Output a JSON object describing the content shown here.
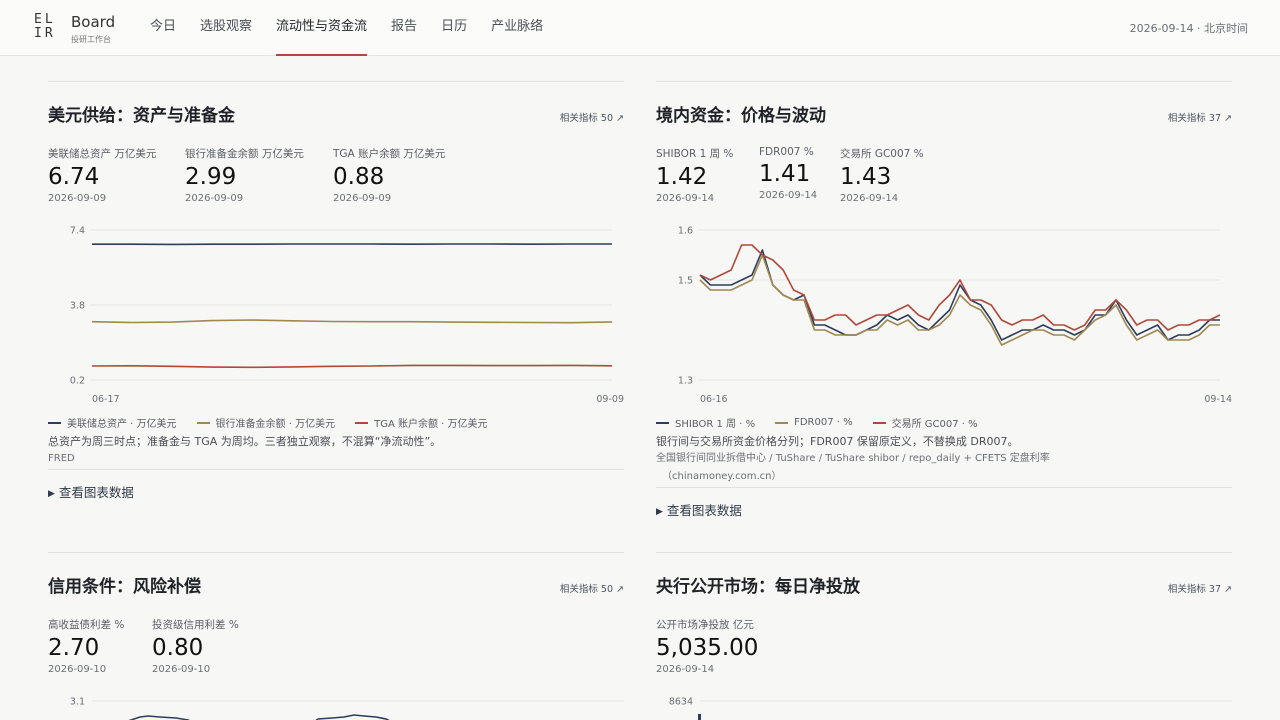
{
  "header": {
    "logo_mark_top": "EL",
    "logo_mark_bottom": "IR",
    "brand": "Board",
    "subtitle": "投研工作台",
    "nav": [
      "今日",
      "选股观察",
      "流动性与资金流",
      "报告",
      "日历",
      "产业脉络"
    ],
    "active_nav": "流动性与资金流",
    "date_time": "2026-09-14 · 北京时间"
  },
  "cards": {
    "usd_supply": {
      "title": "美元供给：资产与准备金",
      "link": "相关指标 50 ↗",
      "metrics": [
        {
          "label": "美联储总资产 万亿美元",
          "value": "6.74",
          "date": "2026-09-09"
        },
        {
          "label": "银行准备金余额 万亿美元",
          "value": "2.99",
          "date": "2026-09-09"
        },
        {
          "label": "TGA 账户余额 万亿美元",
          "value": "0.88",
          "date": "2026-09-09"
        }
      ],
      "legend": [
        "美联储总资产 · 万亿美元",
        "银行准备金余额 · 万亿美元",
        "TGA 账户余额 · 万亿美元"
      ],
      "note": "总资产为周三时点；准备金与 TGA 为周均。三者独立观察，不混算“净流动性”。",
      "source": "FRED",
      "toggle": "查看图表数据"
    },
    "domestic_funding": {
      "title": "境内资金：价格与波动",
      "link": "相关指标 37 ↗",
      "metrics": [
        {
          "label": "SHIBOR 1 周 %",
          "value": "1.42",
          "date": "2026-09-14"
        },
        {
          "label": "FDR007 %",
          "value": "1.41",
          "date": "2026-09-14"
        },
        {
          "label": "交易所 GC007 %",
          "value": "1.43",
          "date": "2026-09-14"
        }
      ],
      "legend": [
        "SHIBOR 1 周 · %",
        "FDR007 · %",
        "交易所 GC007 · %"
      ],
      "note": "银行间与交易所资金价格分列；FDR007 保留原定义，不替换成 DR007。",
      "source_line1": "全国银行间同业拆借中心 / TuShare / TuShare shibor / repo_daily + CFETS 定盘利率",
      "source_line2": "（chinamoney.com.cn）",
      "toggle": "查看图表数据"
    },
    "credit": {
      "title": "信用条件：风险补偿",
      "link": "相关指标 50 ↗",
      "metrics": [
        {
          "label": "高收益债利差 %",
          "value": "2.70",
          "date": "2026-09-10"
        },
        {
          "label": "投资级信用利差 %",
          "value": "0.80",
          "date": "2026-09-10"
        }
      ]
    },
    "pboc_omo": {
      "title": "央行公开市场：每日净投放",
      "link": "相关指标 37 ↗",
      "metrics": [
        {
          "label": "公开市场净投放 亿元",
          "value": "5,035.00",
          "date": "2026-09-14"
        }
      ]
    }
  },
  "colors": {
    "navy": "#2c3e5c",
    "olive": "#a08850",
    "red": "#b0493b",
    "accent_underline": "#b0493b"
  },
  "chart_data": [
    {
      "type": "line",
      "title": "美元供给：资产与准备金",
      "x_labels": [
        "06-17",
        "09-09"
      ],
      "ylim": [
        0.2,
        7.4
      ],
      "yticks": [
        7.4,
        3.8,
        0.2
      ],
      "series": [
        {
          "name": "美联储总资产 · 万亿美元",
          "color": "#2c3e5c",
          "values": [
            6.72,
            6.72,
            6.71,
            6.72,
            6.72,
            6.73,
            6.73,
            6.73,
            6.72,
            6.73,
            6.73,
            6.72,
            6.73,
            6.73
          ]
        },
        {
          "name": "银行准备金余额 · 万亿美元",
          "color": "#a08850",
          "values": [
            3.0,
            2.96,
            2.98,
            3.05,
            3.08,
            3.04,
            3.01,
            3.0,
            3.0,
            2.98,
            2.97,
            2.96,
            2.95,
            2.99
          ]
        },
        {
          "name": "TGA 账户余额 · 万亿美元",
          "color": "#b0493b",
          "values": [
            0.87,
            0.88,
            0.86,
            0.82,
            0.81,
            0.83,
            0.86,
            0.87,
            0.9,
            0.9,
            0.89,
            0.89,
            0.9,
            0.88
          ]
        }
      ]
    },
    {
      "type": "line",
      "title": "境内资金：价格与波动",
      "x_labels": [
        "06-16",
        "09-14"
      ],
      "ylim": [
        1.3,
        1.6
      ],
      "yticks": [
        1.6,
        1.5,
        1.3
      ],
      "series": [
        {
          "name": "SHIBOR 1 周 · %",
          "color": "#2c3e5c",
          "values": [
            1.51,
            1.49,
            1.49,
            1.49,
            1.5,
            1.51,
            1.56,
            1.49,
            1.47,
            1.46,
            1.47,
            1.41,
            1.41,
            1.4,
            1.39,
            1.39,
            1.4,
            1.41,
            1.43,
            1.42,
            1.43,
            1.41,
            1.4,
            1.42,
            1.44,
            1.49,
            1.46,
            1.45,
            1.42,
            1.38,
            1.39,
            1.4,
            1.4,
            1.41,
            1.4,
            1.4,
            1.39,
            1.4,
            1.43,
            1.43,
            1.46,
            1.42,
            1.39,
            1.4,
            1.41,
            1.38,
            1.39,
            1.39,
            1.4,
            1.42,
            1.42
          ]
        },
        {
          "name": "FDR007 · %",
          "color": "#a08850",
          "values": [
            1.5,
            1.48,
            1.48,
            1.48,
            1.49,
            1.5,
            1.55,
            1.49,
            1.47,
            1.46,
            1.46,
            1.4,
            1.4,
            1.39,
            1.39,
            1.39,
            1.4,
            1.4,
            1.42,
            1.41,
            1.42,
            1.4,
            1.4,
            1.41,
            1.43,
            1.47,
            1.45,
            1.44,
            1.41,
            1.37,
            1.38,
            1.39,
            1.4,
            1.4,
            1.39,
            1.39,
            1.38,
            1.4,
            1.42,
            1.43,
            1.45,
            1.41,
            1.38,
            1.39,
            1.4,
            1.38,
            1.38,
            1.38,
            1.39,
            1.41,
            1.41
          ]
        },
        {
          "name": "交易所 GC007 · %",
          "color": "#b0493b",
          "values": [
            1.51,
            1.5,
            1.51,
            1.52,
            1.57,
            1.57,
            1.55,
            1.54,
            1.52,
            1.48,
            1.47,
            1.42,
            1.42,
            1.43,
            1.43,
            1.41,
            1.42,
            1.43,
            1.43,
            1.44,
            1.45,
            1.43,
            1.42,
            1.45,
            1.47,
            1.5,
            1.46,
            1.46,
            1.45,
            1.42,
            1.41,
            1.42,
            1.42,
            1.43,
            1.41,
            1.41,
            1.4,
            1.41,
            1.44,
            1.44,
            1.46,
            1.44,
            1.41,
            1.42,
            1.42,
            1.4,
            1.41,
            1.41,
            1.42,
            1.42,
            1.43
          ]
        }
      ]
    },
    {
      "type": "line",
      "title": "信用条件：风险补偿",
      "yticks": [
        3.1
      ]
    },
    {
      "type": "bar",
      "title": "央行公开市场：每日净投放",
      "yticks": [
        8634
      ]
    }
  ]
}
